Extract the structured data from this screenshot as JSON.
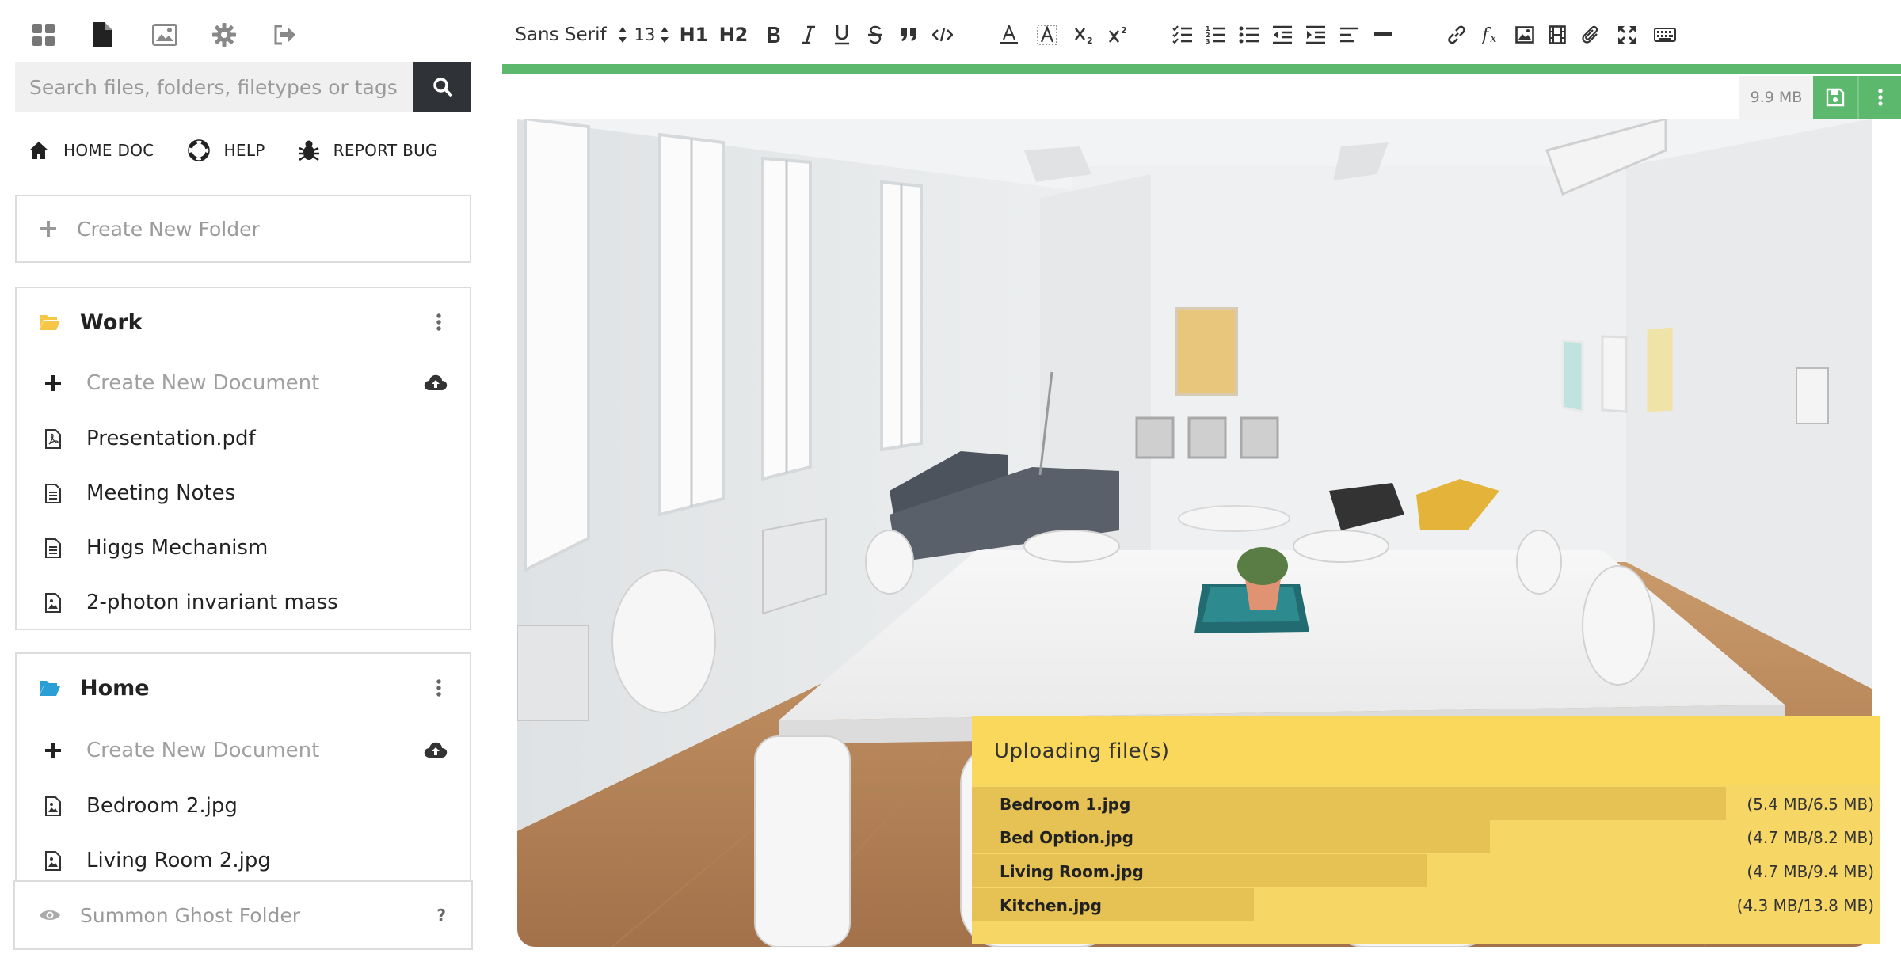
{
  "sidebar": {
    "top_icons": [
      "dashboard-icon",
      "document-icon",
      "image-icon",
      "gear-icon",
      "logout-icon"
    ],
    "search": {
      "placeholder": "Search files, folders, filetypes or tags"
    },
    "quick_links": [
      {
        "label": "HOME DOC",
        "icon": "home-icon"
      },
      {
        "label": "HELP",
        "icon": "lifebuoy-icon"
      },
      {
        "label": "REPORT BUG",
        "icon": "bug-icon"
      }
    ],
    "create_folder_label": "Create New Folder",
    "folders": [
      {
        "name": "Work",
        "icon_color": "#f6c744",
        "create_doc_label": "Create New Document",
        "items": [
          {
            "label": "Presentation.pdf",
            "icon": "pdf-file-icon"
          },
          {
            "label": "Meeting Notes",
            "icon": "text-file-icon"
          },
          {
            "label": "Higgs Mechanism",
            "icon": "text-file-icon"
          },
          {
            "label": "2-photon invariant mass",
            "icon": "image-file-icon"
          }
        ]
      },
      {
        "name": "Home",
        "icon_color": "#2a9fd6",
        "create_doc_label": "Create New Document",
        "items": [
          {
            "label": "Bedroom 2.jpg",
            "icon": "image-file-icon"
          },
          {
            "label": "Living Room 2.jpg",
            "icon": "image-file-icon"
          }
        ]
      }
    ],
    "ghost_folder": {
      "label": "Summon Ghost Folder",
      "help": "?"
    }
  },
  "toolbar": {
    "font": "Sans Serif",
    "size": "13",
    "h1": "H1",
    "h2": "H2"
  },
  "editor": {
    "file_size": "9.9 MB",
    "accent_color": "#5cb86c"
  },
  "upload": {
    "title": "Uploading file(s)",
    "files": [
      {
        "name": "Bedroom 1.jpg",
        "size": "(5.4 MB/6.5 MB)",
        "progress": 0.83
      },
      {
        "name": "Bed Option.jpg",
        "size": "(4.7 MB/8.2 MB)",
        "progress": 0.57
      },
      {
        "name": "Living Room.jpg",
        "size": "(4.7 MB/9.4 MB)",
        "progress": 0.5
      },
      {
        "name": "Kitchen.jpg",
        "size": "(4.3 MB/13.8 MB)",
        "progress": 0.31
      }
    ]
  }
}
